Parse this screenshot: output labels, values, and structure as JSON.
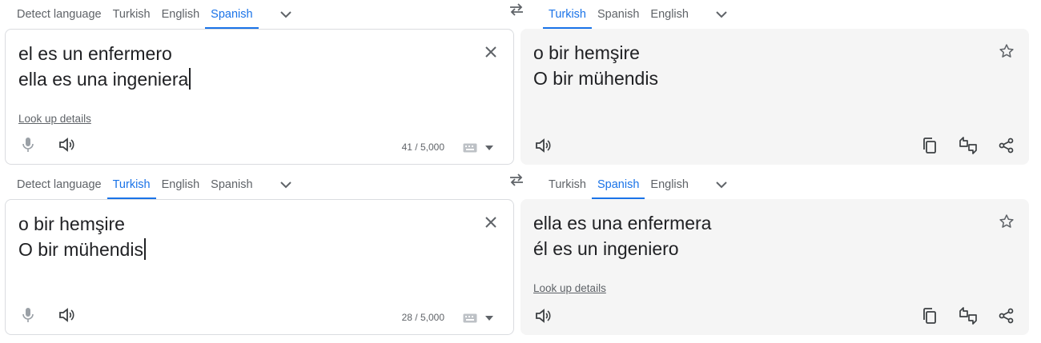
{
  "panels": [
    {
      "source_tabs": [
        "Detect language",
        "Turkish",
        "English",
        "Spanish"
      ],
      "source_active": 3,
      "target_tabs": [
        "Turkish",
        "Spanish",
        "English"
      ],
      "target_active": 0,
      "source_text": "el es un enfermero\nella es una ingeniera",
      "target_text": "o bir hemşire\nO bir mühendis",
      "source_lookup": "Look up details",
      "target_lookup": "",
      "char_count": "41 / 5,000"
    },
    {
      "source_tabs": [
        "Detect language",
        "Turkish",
        "English",
        "Spanish"
      ],
      "source_active": 1,
      "target_tabs": [
        "Turkish",
        "Spanish",
        "English"
      ],
      "target_active": 1,
      "source_text": "o bir hemşire\nO bir mühendis",
      "target_text": "ella es una enfermera\nél es un ingeniero",
      "source_lookup": "",
      "target_lookup": "Look up details",
      "char_count": "28 / 5,000"
    }
  ],
  "icons": {
    "more_languages": "chevron-down-icon",
    "swap": "swap-languages-icon",
    "clear": "close-icon",
    "mic": "microphone-icon",
    "listen": "speaker-icon",
    "keyboard": "keyboard-icon",
    "save": "star-icon",
    "copy": "copy-icon",
    "feedback": "feedback-icon",
    "share": "share-icon"
  },
  "colors": {
    "accent": "#1a73e8",
    "muted": "#5f6368",
    "target_bg": "#f5f5f5",
    "border": "#dadce0"
  }
}
